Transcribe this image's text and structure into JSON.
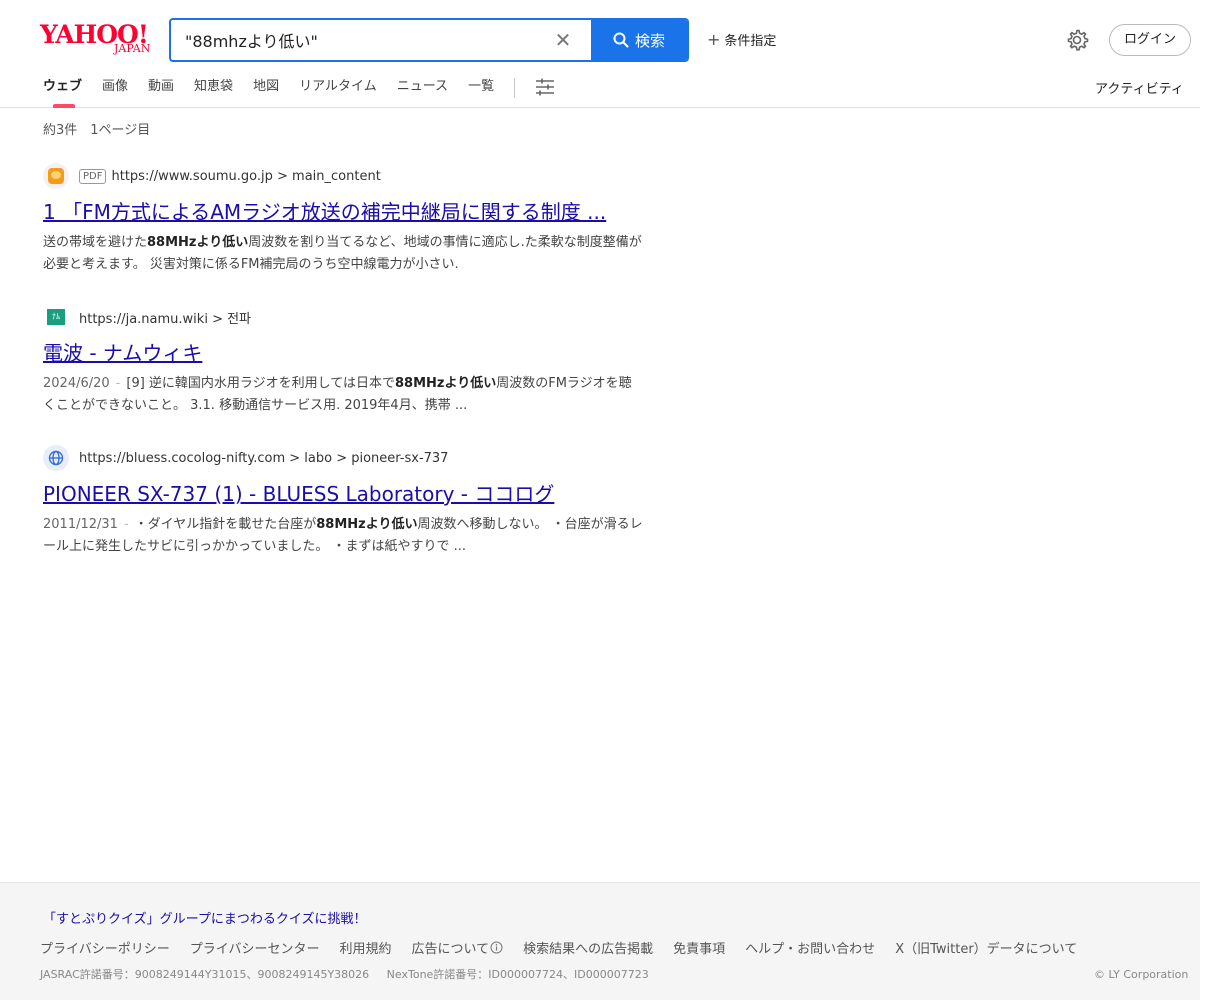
{
  "logo": {
    "main": "YAHOO!",
    "sub": "JAPAN"
  },
  "search": {
    "value": "\"88mhzより低い\"",
    "placeholder": "",
    "clear_label": "✕",
    "button_label": "検索"
  },
  "header": {
    "conditions_label": "条件指定",
    "login_label": "ログイン",
    "activity_label": "アクティビティ"
  },
  "tabs": [
    {
      "label": "ウェブ",
      "active": true
    },
    {
      "label": "画像"
    },
    {
      "label": "動画"
    },
    {
      "label": "知恵袋"
    },
    {
      "label": "地図"
    },
    {
      "label": "リアルタイム"
    },
    {
      "label": "ニュース"
    },
    {
      "label": "一覧"
    }
  ],
  "results_meta": {
    "count_text": "約3件　1ページ目"
  },
  "results": [
    {
      "badge": "PDF",
      "url": "https://www.soumu.go.jp > main_content",
      "title": "1 「FM方式によるAMラジオ放送の補完中継局に関する制度 ...",
      "snippet_pre": "送の帯域を避けた",
      "snippet_bold": "88MHzより低い",
      "snippet_post": "周波数を割り当てるなど、地域の事情に適応し.た柔軟な制度整備が必要と考えます。 災害対策に係るFM補完局のうち空中線電力が小さい."
    },
    {
      "url": "https://ja.namu.wiki > 전파",
      "title": "電波 - ナムウィキ",
      "date": "2024/6/20",
      "snippet_pre": "[9] 逆に韓国内水用ラジオを利用しては日本で",
      "snippet_bold": "88MHzより低い",
      "snippet_post": "周波数のFMラジオを聴くことができないこと。 3.1. 移動通信サービス用. 2019年4月、携帯 ..."
    },
    {
      "url": "https://bluess.cocolog-nifty.com > labo > pioneer-sx-737",
      "title": "PIONEER SX-737 (1) - BLUESS Laboratory - ココログ",
      "date": "2011/12/31",
      "snippet_pre": "・ダイヤル指針を載せた台座が",
      "snippet_bold": "88MHzより低い",
      "snippet_post": "周波数へ移動しない。 ・台座が滑るレール上に発生したサビに引っかかっていました。 ・まずは紙やすりで ..."
    }
  ],
  "footer": {
    "promo": "「すとぷりクイズ」グループにまつわるクイズに挑戦！",
    "links": [
      "プライバシーポリシー",
      "プライバシーセンター",
      "利用規約",
      "広告について",
      "検索結果への広告掲載",
      "免責事項",
      "ヘルプ・お問い合わせ",
      "X（旧Twitter）データについて"
    ],
    "jasrac": "JASRAC許諾番号：9008249144Y31015、9008249145Y38026",
    "nextone": "NexTone許諾番号：ID000007724、ID000007723",
    "copyright": "© LY Corporation"
  },
  "colors": {
    "brand": "#ff0033",
    "accent": "#1a73e8",
    "link": "#1a0dab",
    "tab_indicator": "#ff4a66"
  },
  "icons": [
    "search-icon",
    "close-icon",
    "plus-icon",
    "gear-icon",
    "filter-icon",
    "globe-icon",
    "info-icon"
  ]
}
